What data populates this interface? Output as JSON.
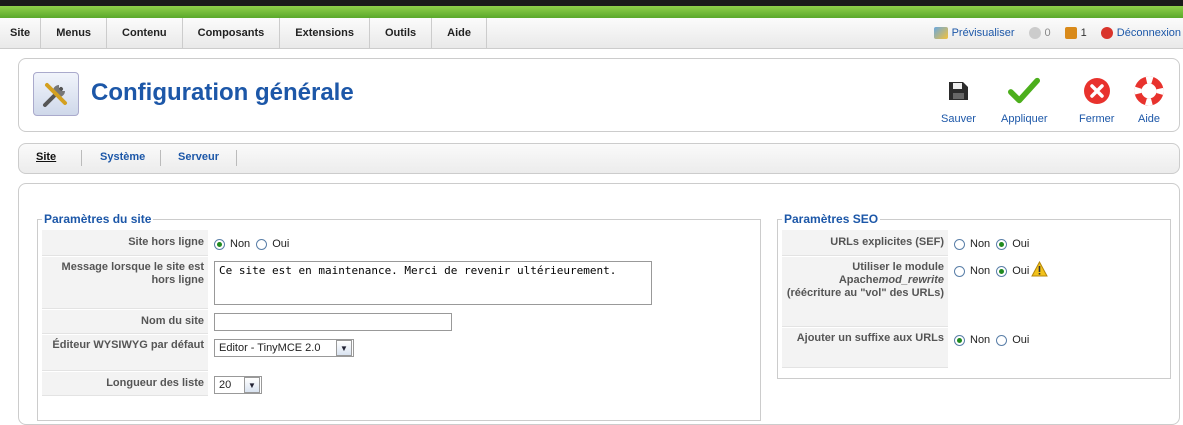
{
  "menu": {
    "items": [
      {
        "label": "Site"
      },
      {
        "label": "Menus"
      },
      {
        "label": "Contenu"
      },
      {
        "label": "Composants"
      },
      {
        "label": "Extensions"
      },
      {
        "label": "Outils"
      },
      {
        "label": "Aide"
      }
    ]
  },
  "status": {
    "preview_label": "Prévisualiser",
    "messages_count": "0",
    "users_count": "1",
    "logout_label": "Déconnexion"
  },
  "header": {
    "title": "Configuration générale"
  },
  "toolbar": {
    "save_label": "Sauver",
    "apply_label": "Appliquer",
    "close_label": "Fermer",
    "help_label": "Aide"
  },
  "tabs": [
    {
      "label": "Site",
      "active": true
    },
    {
      "label": "Système",
      "active": false
    },
    {
      "label": "Serveur",
      "active": false
    }
  ],
  "site_params": {
    "legend": "Paramètres du site",
    "offline_label": "Site hors ligne",
    "offline_value": "Non",
    "radio_no": "Non",
    "radio_yes": "Oui",
    "offline_message_label": "Message lorsque le site est hors ligne",
    "offline_message_value": "Ce site est en maintenance. Merci de revenir ultérieurement.",
    "sitename_label": "Nom du site",
    "sitename_value": "",
    "editor_label": "Éditeur WYSIWYG par défaut",
    "editor_value": "Editor - TinyMCE 2.0",
    "list_length_label": "Longueur des liste",
    "list_length_value": "20"
  },
  "seo_params": {
    "legend": "Paramètres SEO",
    "sef_label": "URLs explicites (SEF)",
    "sef_value": "Oui",
    "rewrite_label_part1": "Utiliser le module Apache",
    "rewrite_label_em": "mod_rewrite",
    "rewrite_label_part2": " (réécriture au \"vol\" des URLs)",
    "rewrite_value": "Oui",
    "suffix_label": "Ajouter un suffixe aux URLs",
    "suffix_value": "Non",
    "radio_no": "Non",
    "radio_yes": "Oui"
  },
  "colors": {
    "accent": "#1c57a8",
    "green_bar": "#6fbe38",
    "apply_green": "#4caf1c",
    "close_red": "#e8322d"
  }
}
